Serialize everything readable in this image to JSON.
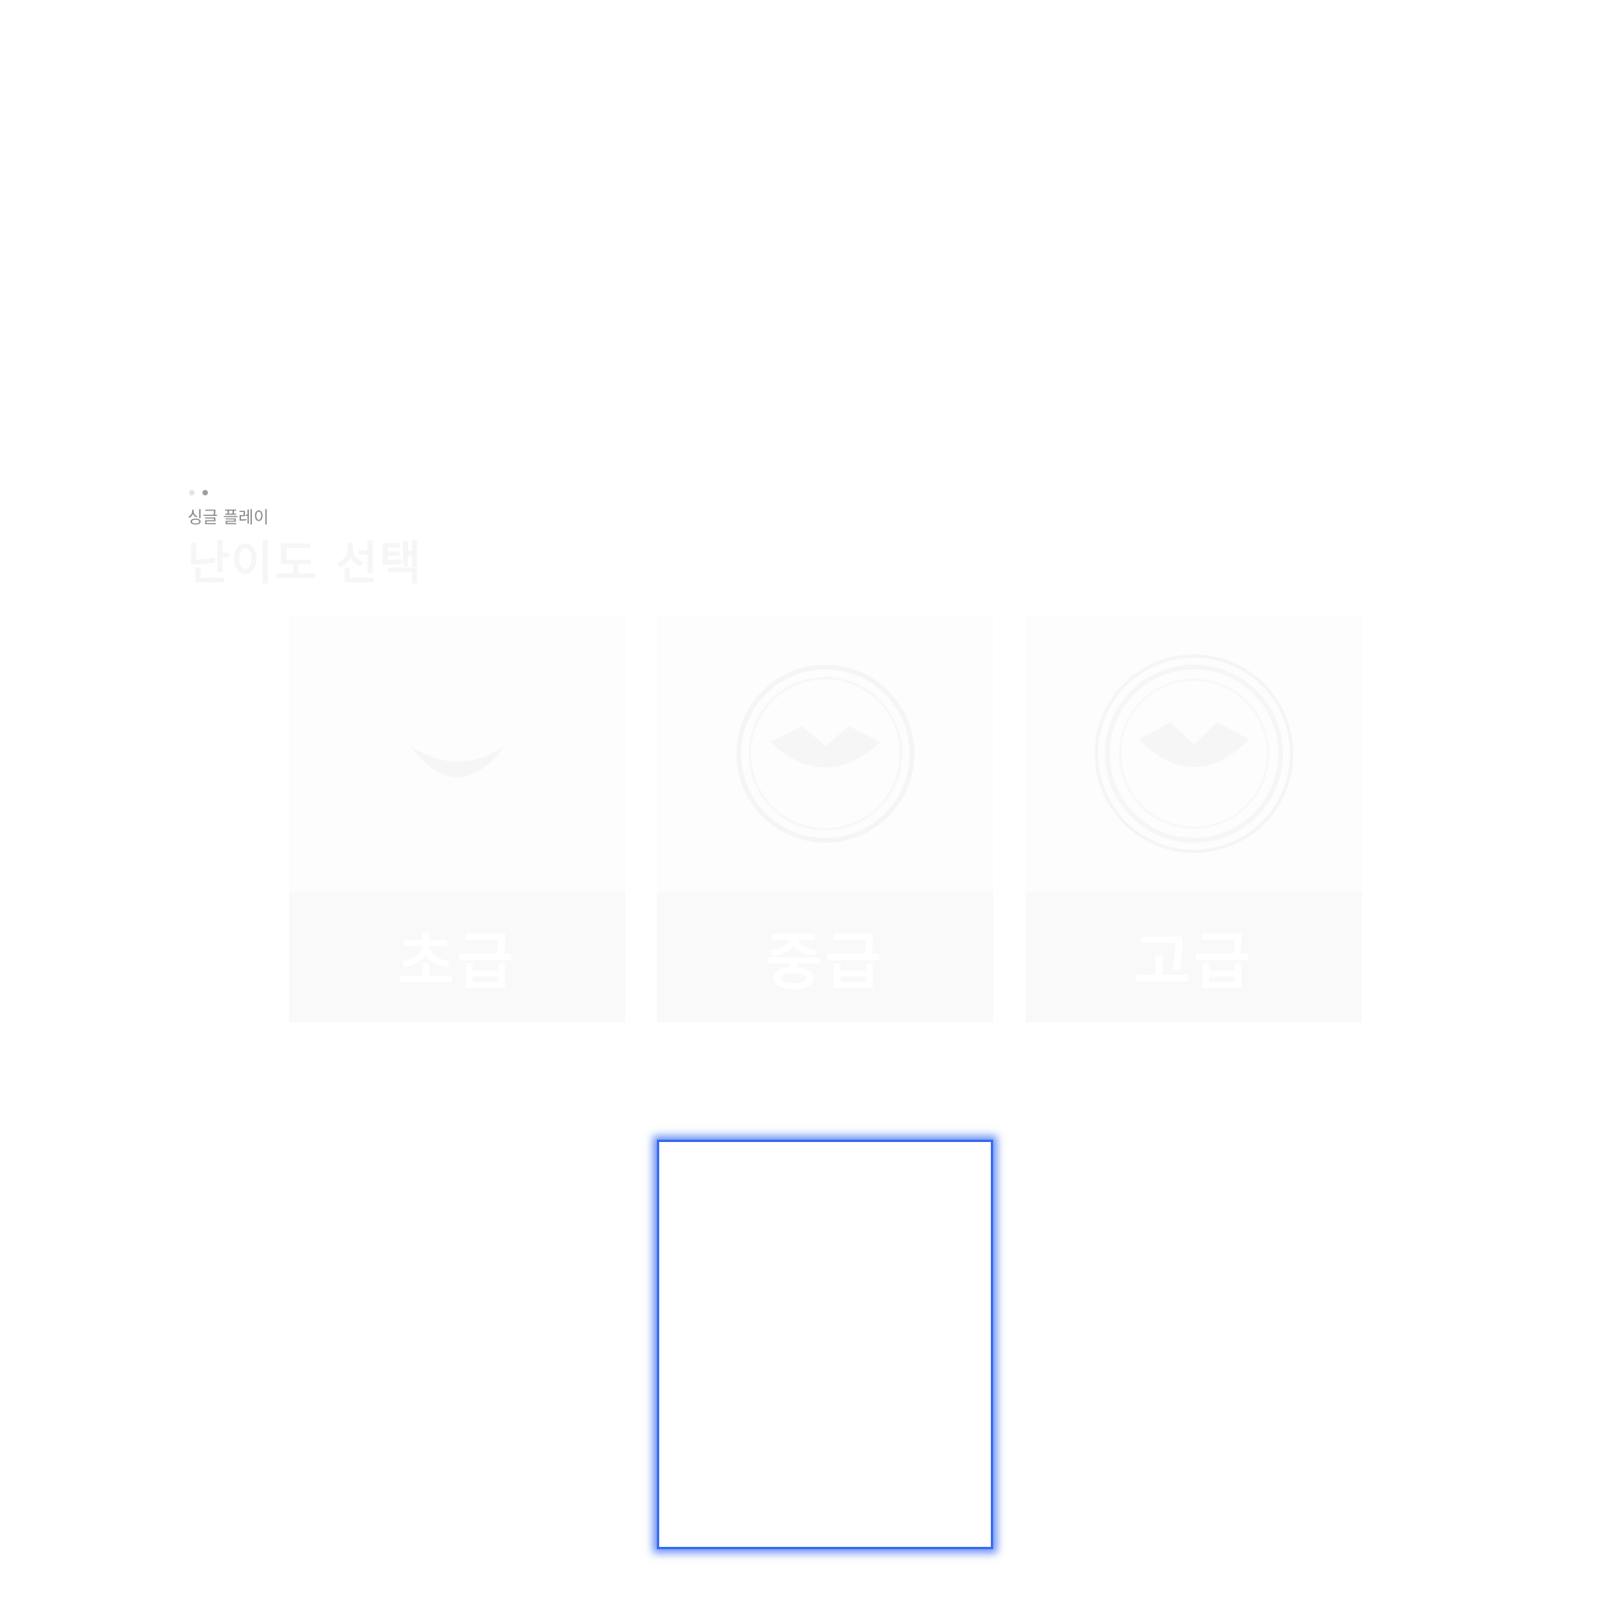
{
  "header": {
    "dots": [
      {
        "active": false
      },
      {
        "active": true
      }
    ],
    "breadcrumb": "싱글 플레이",
    "title": "난이도 선택"
  },
  "levels": [
    {
      "label": "초급",
      "icon": "smile-face-icon"
    },
    {
      "label": "중급",
      "icon": "smile-circle-icon"
    },
    {
      "label": "고급",
      "icon": "smile-double-circle-icon"
    }
  ],
  "colors": {
    "accent": "#3a6cf0",
    "breadcrumb_text": "#8a8a8a",
    "card_bottom": "#f9f9f9"
  }
}
